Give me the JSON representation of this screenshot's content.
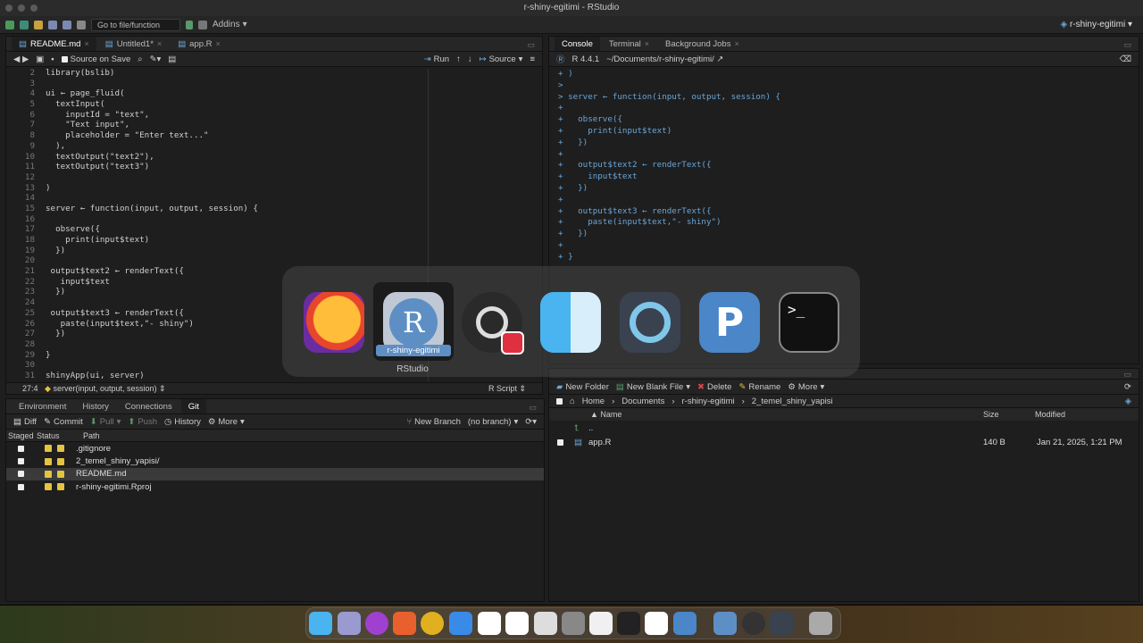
{
  "window": {
    "title": "r-shiny-egitimi - RStudio"
  },
  "toolbar": {
    "goto_placeholder": "Go to file/function",
    "addins": "Addins",
    "project": "r-shiny-egitimi"
  },
  "editor": {
    "tabs": [
      "README.md",
      "Untitled1*",
      "app.R"
    ],
    "source_on_save": "Source on Save",
    "run": "Run",
    "source": "Source",
    "lines": [
      {
        "n": "2",
        "t": "library(bslib)"
      },
      {
        "n": "3",
        "t": ""
      },
      {
        "n": "4",
        "t": "ui ← page_fluid("
      },
      {
        "n": "5",
        "t": "  textInput("
      },
      {
        "n": "6",
        "t": "    inputId = \"text\","
      },
      {
        "n": "7",
        "t": "    \"Text input\","
      },
      {
        "n": "8",
        "t": "    placeholder = \"Enter text...\""
      },
      {
        "n": "9",
        "t": "  ),"
      },
      {
        "n": "10",
        "t": "  textOutput(\"text2\"),"
      },
      {
        "n": "11",
        "t": "  textOutput(\"text3\")"
      },
      {
        "n": "12",
        "t": ""
      },
      {
        "n": "13",
        "t": ")"
      },
      {
        "n": "14",
        "t": ""
      },
      {
        "n": "15",
        "t": "server ← function(input, output, session) {"
      },
      {
        "n": "16",
        "t": ""
      },
      {
        "n": "17",
        "t": "  observe({"
      },
      {
        "n": "18",
        "t": "    print(input$text)"
      },
      {
        "n": "19",
        "t": "  })"
      },
      {
        "n": "20",
        "t": ""
      },
      {
        "n": "21",
        "t": " output$text2 ← renderText({"
      },
      {
        "n": "22",
        "t": "   input$text"
      },
      {
        "n": "23",
        "t": "  })"
      },
      {
        "n": "24",
        "t": ""
      },
      {
        "n": "25",
        "t": " output$text3 ← renderText({"
      },
      {
        "n": "26",
        "t": "   paste(input$text,\"- shiny\")"
      },
      {
        "n": "27",
        "t": "  })"
      },
      {
        "n": "28",
        "t": ""
      },
      {
        "n": "29",
        "t": "}"
      },
      {
        "n": "30",
        "t": ""
      },
      {
        "n": "31",
        "t": "shinyApp(ui, server)"
      }
    ],
    "status_pos": "27:4",
    "status_fn": "server(input, output, session)",
    "status_type": "R Script"
  },
  "console": {
    "tabs": [
      "Console",
      "Terminal",
      "Background Jobs"
    ],
    "version": "R 4.4.1",
    "path": "~/Documents/r-shiny-egitimi/",
    "lines": [
      "+ )",
      ">",
      "> server ← function(input, output, session) {",
      "+",
      "+   observe({",
      "+     print(input$text)",
      "+   })",
      "+",
      "+   output$text2 ← renderText({",
      "+     input$text",
      "+   })",
      "+",
      "+   output$text3 ← renderText({",
      "+     paste(input$text,\"- shiny\")",
      "+   })",
      "+",
      "+ }"
    ]
  },
  "vcs": {
    "tabs": [
      "Environment",
      "History",
      "Connections",
      "Git"
    ],
    "buttons": [
      "Diff",
      "Commit",
      "Pull",
      "Push",
      "History",
      "More"
    ],
    "new_branch": "New Branch",
    "branch": "(no branch)",
    "headers": [
      "Staged",
      "Status",
      "Path"
    ],
    "files": [
      ".gitignore",
      "2_temel_shiny_yapisi/",
      "README.md",
      "r-shiny-egitimi.Rproj"
    ]
  },
  "files": {
    "buttons": [
      "New Folder",
      "New Blank File",
      "Delete",
      "Rename",
      "More"
    ],
    "breadcrumb": [
      "Home",
      "Documents",
      "r-shiny-egitimi",
      "2_temel_shiny_yapisi"
    ],
    "headers": {
      "name": "Name",
      "size": "Size",
      "modified": "Modified"
    },
    "up": "..",
    "rows": [
      {
        "name": "app.R",
        "size": "140 B",
        "modified": "Jan 21, 2025, 1:21 PM"
      }
    ]
  },
  "switcher": {
    "selected_label": "r-shiny-egitimi",
    "selected_app": "RStudio",
    "apps": [
      "firefox-icon",
      "rstudio-icon",
      "obs-icon",
      "finder-icon",
      "quicktime-icon",
      "positron-icon",
      "terminal-icon"
    ]
  },
  "colors": {
    "accent": "#6aa6d8",
    "git_status": "#e4c33f",
    "bg": "#1e1e1e"
  }
}
